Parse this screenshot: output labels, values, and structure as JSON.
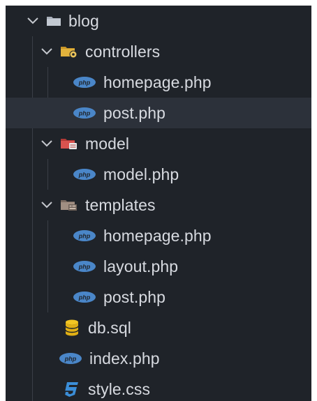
{
  "tree": {
    "root": {
      "label": "blog",
      "icon": "folder-icon",
      "expanded": true
    },
    "controllers": {
      "label": "controllers",
      "icon": "folder-config-icon",
      "expanded": true
    },
    "controllers_files": [
      {
        "label": "homepage.php",
        "icon": "php-icon"
      },
      {
        "label": "post.php",
        "icon": "php-icon",
        "selected": true
      }
    ],
    "model": {
      "label": "model",
      "icon": "folder-database-icon",
      "expanded": true
    },
    "model_files": [
      {
        "label": "model.php",
        "icon": "php-icon"
      }
    ],
    "templates": {
      "label": "templates",
      "icon": "folder-templates-icon",
      "expanded": true
    },
    "templates_files": [
      {
        "label": "homepage.php",
        "icon": "php-icon"
      },
      {
        "label": "layout.php",
        "icon": "php-icon"
      },
      {
        "label": "post.php",
        "icon": "php-icon"
      }
    ],
    "root_files": [
      {
        "label": "db.sql",
        "icon": "database-icon"
      },
      {
        "label": "index.php",
        "icon": "php-icon"
      },
      {
        "label": "style.css",
        "icon": "css-icon"
      }
    ]
  },
  "colors": {
    "background": "#1f2329",
    "selected_row": "#2c313a",
    "text": "#d7dae0",
    "php_blue": "#4a86c8",
    "folder_gray": "#a9b0bb",
    "folder_yellow": "#e2b23c",
    "folder_red": "#d9534f",
    "db_yellow": "#f3c623",
    "css_blue": "#3b8ed8"
  }
}
